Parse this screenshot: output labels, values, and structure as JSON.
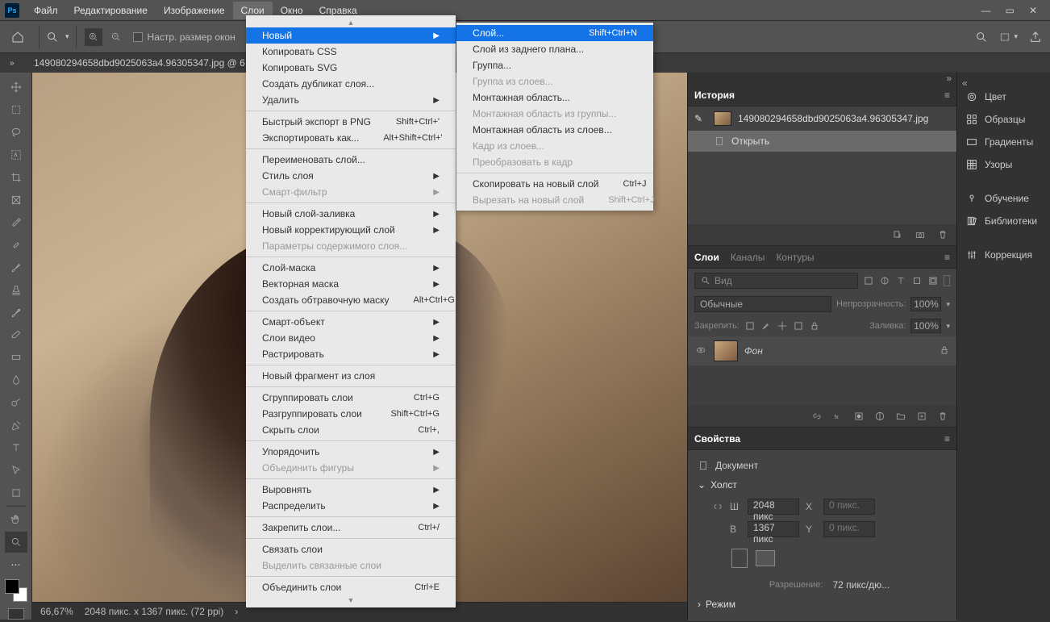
{
  "menubar": {
    "items": [
      "Файл",
      "Редактирование",
      "Изображение",
      "Слои",
      "Окно",
      "Справка"
    ],
    "active_index": 3
  },
  "optionbar": {
    "resize_windows_label": "Настр. размер окон"
  },
  "document": {
    "tab_label": "149080294658dbd9025063a4.96305347.jpg @ 6",
    "filename": "149080294658dbd9025063a4.96305347.jpg"
  },
  "layer_menu": {
    "items": [
      {
        "label": "Новый",
        "sub": true,
        "hl": true
      },
      {
        "label": "Копировать CSS"
      },
      {
        "label": "Копировать SVG"
      },
      {
        "label": "Создать дубликат слоя..."
      },
      {
        "label": "Удалить",
        "sub": true
      },
      {
        "sep": true
      },
      {
        "label": "Быстрый экспорт в PNG",
        "shortcut": "Shift+Ctrl+'"
      },
      {
        "label": "Экспортировать как...",
        "shortcut": "Alt+Shift+Ctrl+'"
      },
      {
        "sep": true
      },
      {
        "label": "Переименовать слой..."
      },
      {
        "label": "Стиль слоя",
        "sub": true
      },
      {
        "label": "Смарт-фильтр",
        "sub": true,
        "disabled": true
      },
      {
        "sep": true
      },
      {
        "label": "Новый слой-заливка",
        "sub": true
      },
      {
        "label": "Новый корректирующий слой",
        "sub": true
      },
      {
        "label": "Параметры содержимого слоя...",
        "disabled": true
      },
      {
        "sep": true
      },
      {
        "label": "Слой-маска",
        "sub": true
      },
      {
        "label": "Векторная маска",
        "sub": true
      },
      {
        "label": "Создать обтравочную маску",
        "shortcut": "Alt+Ctrl+G"
      },
      {
        "sep": true
      },
      {
        "label": "Смарт-объект",
        "sub": true
      },
      {
        "label": "Слои видео",
        "sub": true
      },
      {
        "label": "Растрировать",
        "sub": true
      },
      {
        "sep": true
      },
      {
        "label": "Новый фрагмент из слоя"
      },
      {
        "sep": true
      },
      {
        "label": "Сгруппировать слои",
        "shortcut": "Ctrl+G"
      },
      {
        "label": "Разгруппировать слои",
        "shortcut": "Shift+Ctrl+G"
      },
      {
        "label": "Скрыть слои",
        "shortcut": "Ctrl+,"
      },
      {
        "sep": true
      },
      {
        "label": "Упорядочить",
        "sub": true
      },
      {
        "label": "Объединить фигуры",
        "sub": true,
        "disabled": true
      },
      {
        "sep": true
      },
      {
        "label": "Выровнять",
        "sub": true
      },
      {
        "label": "Распределить",
        "sub": true
      },
      {
        "sep": true
      },
      {
        "label": "Закрепить слои...",
        "shortcut": "Ctrl+/"
      },
      {
        "sep": true
      },
      {
        "label": "Связать слои"
      },
      {
        "label": "Выделить связанные слои",
        "disabled": true
      },
      {
        "sep": true
      },
      {
        "label": "Объединить слои",
        "shortcut": "Ctrl+E"
      }
    ]
  },
  "submenu_new": {
    "items": [
      {
        "label": "Слой...",
        "shortcut": "Shift+Ctrl+N",
        "hl": true
      },
      {
        "label": "Слой из заднего плана..."
      },
      {
        "label": "Группа..."
      },
      {
        "label": "Группа из слоев...",
        "disabled": true
      },
      {
        "label": "Монтажная область..."
      },
      {
        "label": "Монтажная область из группы...",
        "disabled": true
      },
      {
        "label": "Монтажная область из слоев..."
      },
      {
        "label": "Кадр из слоев...",
        "disabled": true
      },
      {
        "label": "Преобразовать в кадр",
        "disabled": true
      },
      {
        "sep": true
      },
      {
        "label": "Скопировать на новый слой",
        "shortcut": "Ctrl+J"
      },
      {
        "label": "Вырезать на новый слой",
        "shortcut": "Shift+Ctrl+J",
        "disabled": true
      }
    ]
  },
  "history": {
    "tab": "История",
    "open_label": "Открыть"
  },
  "layers_panel": {
    "tabs": [
      "Слои",
      "Каналы",
      "Контуры"
    ],
    "search_placeholder": "Вид",
    "mode": "Обычные",
    "opacity_label": "Непрозрачность:",
    "opacity": "100%",
    "lock_label": "Закрепить:",
    "fill_label": "Заливка:",
    "fill": "100%",
    "layer_name": "Фон"
  },
  "properties": {
    "tab": "Свойства",
    "doc_label": "Документ",
    "canvas_label": "Холст",
    "width_label": "Ш",
    "width": "2048 пикс",
    "height_label": "В",
    "height": "1367 пикс",
    "x_label": "X",
    "x": "0 пикс.",
    "y_label": "Y",
    "y": "0 пикс.",
    "res_label": "Разрешение:",
    "res": "72 пикс/дю...",
    "mode_label": "Режим"
  },
  "far_right": {
    "items": [
      {
        "icon": "color",
        "label": "Цвет"
      },
      {
        "icon": "swatches",
        "label": "Образцы"
      },
      {
        "icon": "gradients",
        "label": "Градиенты"
      },
      {
        "icon": "patterns",
        "label": "Узоры"
      },
      {
        "gap": true
      },
      {
        "icon": "learn",
        "label": "Обучение"
      },
      {
        "icon": "libs",
        "label": "Библиотеки"
      },
      {
        "gap": true
      },
      {
        "icon": "adjust",
        "label": "Коррекция"
      }
    ]
  },
  "status": {
    "zoom": "66,67%",
    "info": "2048 пикс. x 1367 пикс. (72 ppi)"
  }
}
